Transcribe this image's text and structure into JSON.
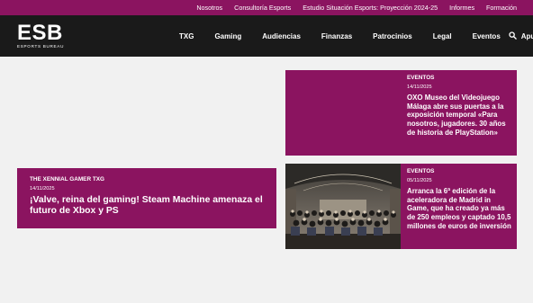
{
  "topbar": {
    "links": [
      "Nosotros",
      "Consultoría Esports",
      "Estudio Situación Esports: Proyección 2024-25",
      "Informes",
      "Formación"
    ]
  },
  "header": {
    "logo_text": "ESB",
    "logo_subtitle": "ESPORTS BUREAU",
    "nav": [
      "TXG",
      "Gaming",
      "Audiencias",
      "Finanzas",
      "Patrocinios",
      "Legal",
      "Eventos",
      "Apuestas"
    ],
    "search_icon": "search-icon"
  },
  "articles": [
    {
      "category": "EVENTOS",
      "date": "14/11/2025",
      "title": "OXO Museo del Videojuego Málaga abre sus puertas a la exposición temporal «Para nosotros, jugadores. 30 años de historia de PlayStation»"
    },
    {
      "category": "EVENTOS",
      "date": "05/11/2025",
      "title": "Arranca la 6ª edición de la aceleradora de Madrid in Game, que ha creado ya más de 250 empleos y captado 10,5 millones de euros de inversión"
    },
    {
      "category": "THE XENNIAL GAMER TXG",
      "date": "14/11/2025",
      "title": "¡Valve, reina del gaming! Steam Machine amenaza el futuro de Xbox y PS"
    }
  ],
  "colors": {
    "brand": "#8b1460",
    "header_bg": "#1a1a1a",
    "page_bg": "#f1f1f1"
  }
}
